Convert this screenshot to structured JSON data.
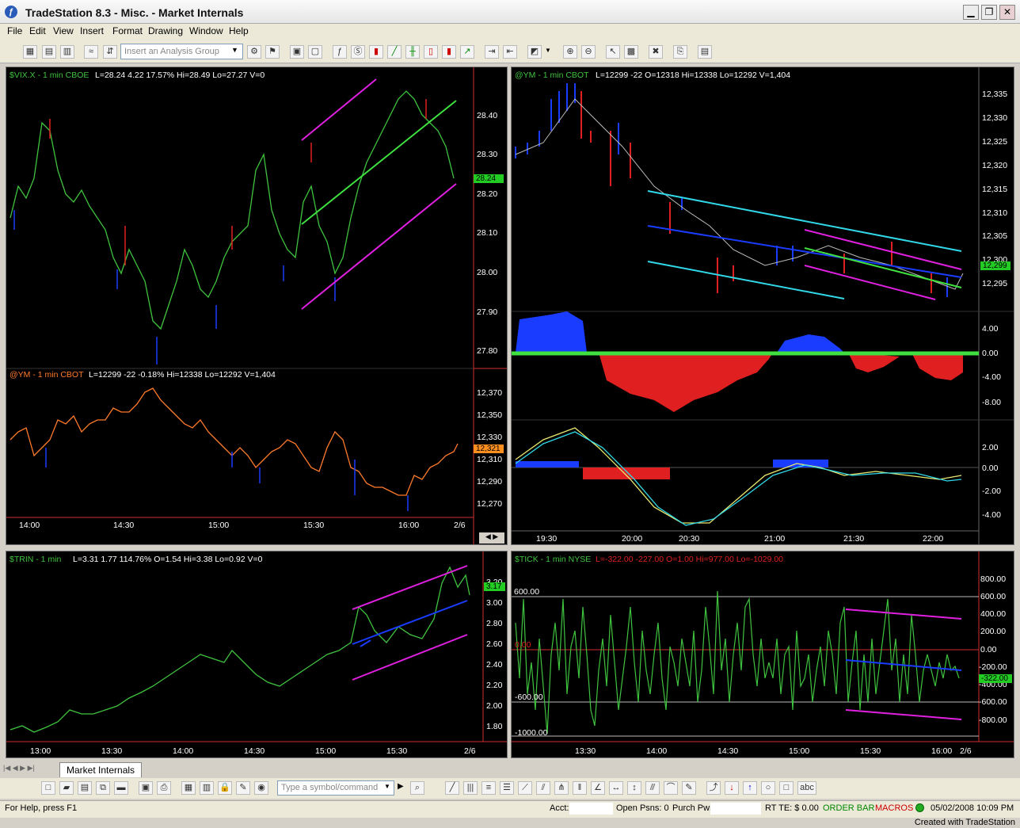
{
  "window": {
    "title": "TradeStation 8.3 - Misc. - Market Internals",
    "min": "▁",
    "restore": "❐",
    "close": "✕"
  },
  "menu": [
    "File",
    "Edit",
    "View",
    "Insert",
    "Format",
    "Drawing",
    "Window",
    "Help"
  ],
  "toolbar": {
    "analysis_placeholder": "Insert an Analysis Group"
  },
  "vix": {
    "header_sym": "$VIX.X - 1 min  CBOE",
    "header_vals": "L=28.24  4.22  17.57%  Hi=28.49  Lo=27.27  V=0",
    "axis": [
      "28.40",
      "28.30",
      "28.20",
      "28.10",
      "28.00",
      "27.90",
      "27.80"
    ],
    "last": "28.24"
  },
  "ym_left": {
    "header_sym": "@YM - 1 min  CBOT",
    "header_vals": "L=12299  -22  -0.18%  Hi=12338  Lo=12292  V=1,404",
    "axis": [
      "12,370",
      "12,350",
      "12,330",
      "12,310",
      "12,290",
      "12,270"
    ],
    "last": "12,321",
    "xaxis": [
      "14:00",
      "14:30",
      "15:00",
      "15:30",
      "16:00",
      "2/6"
    ]
  },
  "ym_right": {
    "header_sym": "@YM - 1 min  CBOT",
    "header_vals": "L=12299  -22  O=12318  Hi=12338  Lo=12292  V=1,404",
    "axis": [
      "12,335",
      "12,330",
      "12,325",
      "12,320",
      "12,315",
      "12,310",
      "12,305",
      "12,300",
      "12,295"
    ],
    "last": "12,299",
    "osc1_axis": [
      "4.00",
      "0.00",
      "-4.00",
      "-8.00"
    ],
    "osc2_axis": [
      "2.00",
      "0.00",
      "-2.00",
      "-4.00"
    ],
    "xaxis": [
      "19:30",
      "20:00",
      "20:30",
      "21:00",
      "21:30",
      "22:00"
    ]
  },
  "trin": {
    "header_sym": "$TRIN - 1 min",
    "header_vals": "L=3.31  1.77  114.76%  O=1.54  Hi=3.38  Lo=0.92  V=0",
    "axis": [
      "3.20",
      "3.00",
      "2.80",
      "2.60",
      "2.40",
      "2.20",
      "2.00",
      "1.80"
    ],
    "last": "3.17",
    "xaxis": [
      "13:00",
      "13:30",
      "14:00",
      "14:30",
      "15:00",
      "15:30",
      "2/6"
    ]
  },
  "tick": {
    "header_sym": "$TICK - 1 min  NYSE",
    "header_vals": "L=-322.00  -227.00  O=1.00  Hi=977.00  Lo=-1029.00",
    "axis": [
      "800.00",
      "600.00",
      "400.00",
      "200.00",
      "0.00",
      "-200.00",
      "-400.00",
      "-600.00",
      "-800.00"
    ],
    "last": "-322.00",
    "levels": [
      "600.00",
      "0.00",
      "-600.00",
      "-1000.00"
    ],
    "xaxis": [
      "13:30",
      "14:00",
      "14:30",
      "15:00",
      "15:30",
      "16:00",
      "2/6"
    ]
  },
  "tabs": {
    "active": "Market Internals"
  },
  "toolbar2": {
    "symbol_placeholder": "Type a symbol/command",
    "text_tool": "abc"
  },
  "status": {
    "help": "For Help, press F1",
    "acct": "Acct:",
    "open_psns": "Open Psns: 0",
    "purch": "Purch Pwr",
    "rt": "RT TE: $ 0.00",
    "order_bar": "ORDER BAR",
    "macros": "MACROS",
    "datetime": "05/02/2008 10:09 PM"
  },
  "footer": "Created with TradeStation",
  "colors": {
    "up": "#3fc33f",
    "down": "#e02020",
    "blue": "#1a3cff",
    "magenta": "#e020e0",
    "cyan": "#30d8e8",
    "orange": "#ff7a2a",
    "yellow": "#e8e870"
  }
}
